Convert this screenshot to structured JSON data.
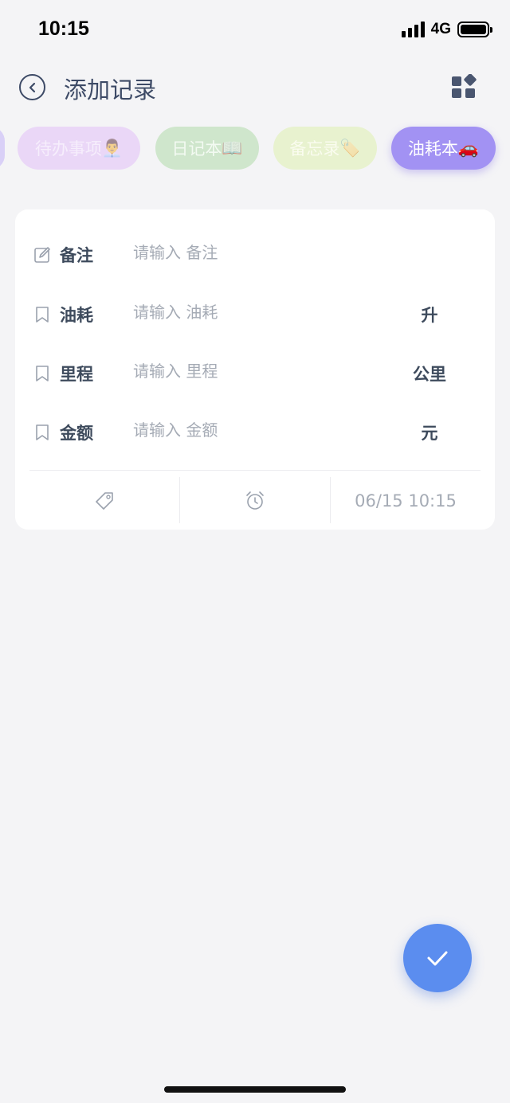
{
  "status_bar": {
    "time": "10:15",
    "network": "4G"
  },
  "header": {
    "title": "添加记录",
    "back_icon": "chevron-left-icon",
    "menu_icon": "grid-icon"
  },
  "chips": [
    {
      "label": "待办事项",
      "emoji": "👨‍💼"
    },
    {
      "label": "日记本",
      "emoji": "📖"
    },
    {
      "label": "备忘录",
      "emoji": "🏷️"
    },
    {
      "label": "油耗本",
      "emoji": "🚗",
      "selected": true
    }
  ],
  "form": {
    "rows": [
      {
        "label": "备注",
        "placeholder": "请输入 备注",
        "unit": "",
        "icon": "edit-icon"
      },
      {
        "label": "油耗",
        "placeholder": "请输入 油耗",
        "unit": "升",
        "icon": "bookmark-icon"
      },
      {
        "label": "里程",
        "placeholder": "请输入 里程",
        "unit": "公里",
        "icon": "bookmark-icon"
      },
      {
        "label": "金额",
        "placeholder": "请输入 金额",
        "unit": "元",
        "icon": "bookmark-icon"
      }
    ],
    "footer": {
      "tag_icon": "tag-icon",
      "alarm_icon": "alarm-clock-icon",
      "datetime": "06/15 10:15"
    }
  },
  "fab": {
    "icon": "check-icon"
  },
  "colors": {
    "accent": "#5b8def",
    "selected_chip": "#a292f3",
    "background": "#f4f4f6"
  }
}
